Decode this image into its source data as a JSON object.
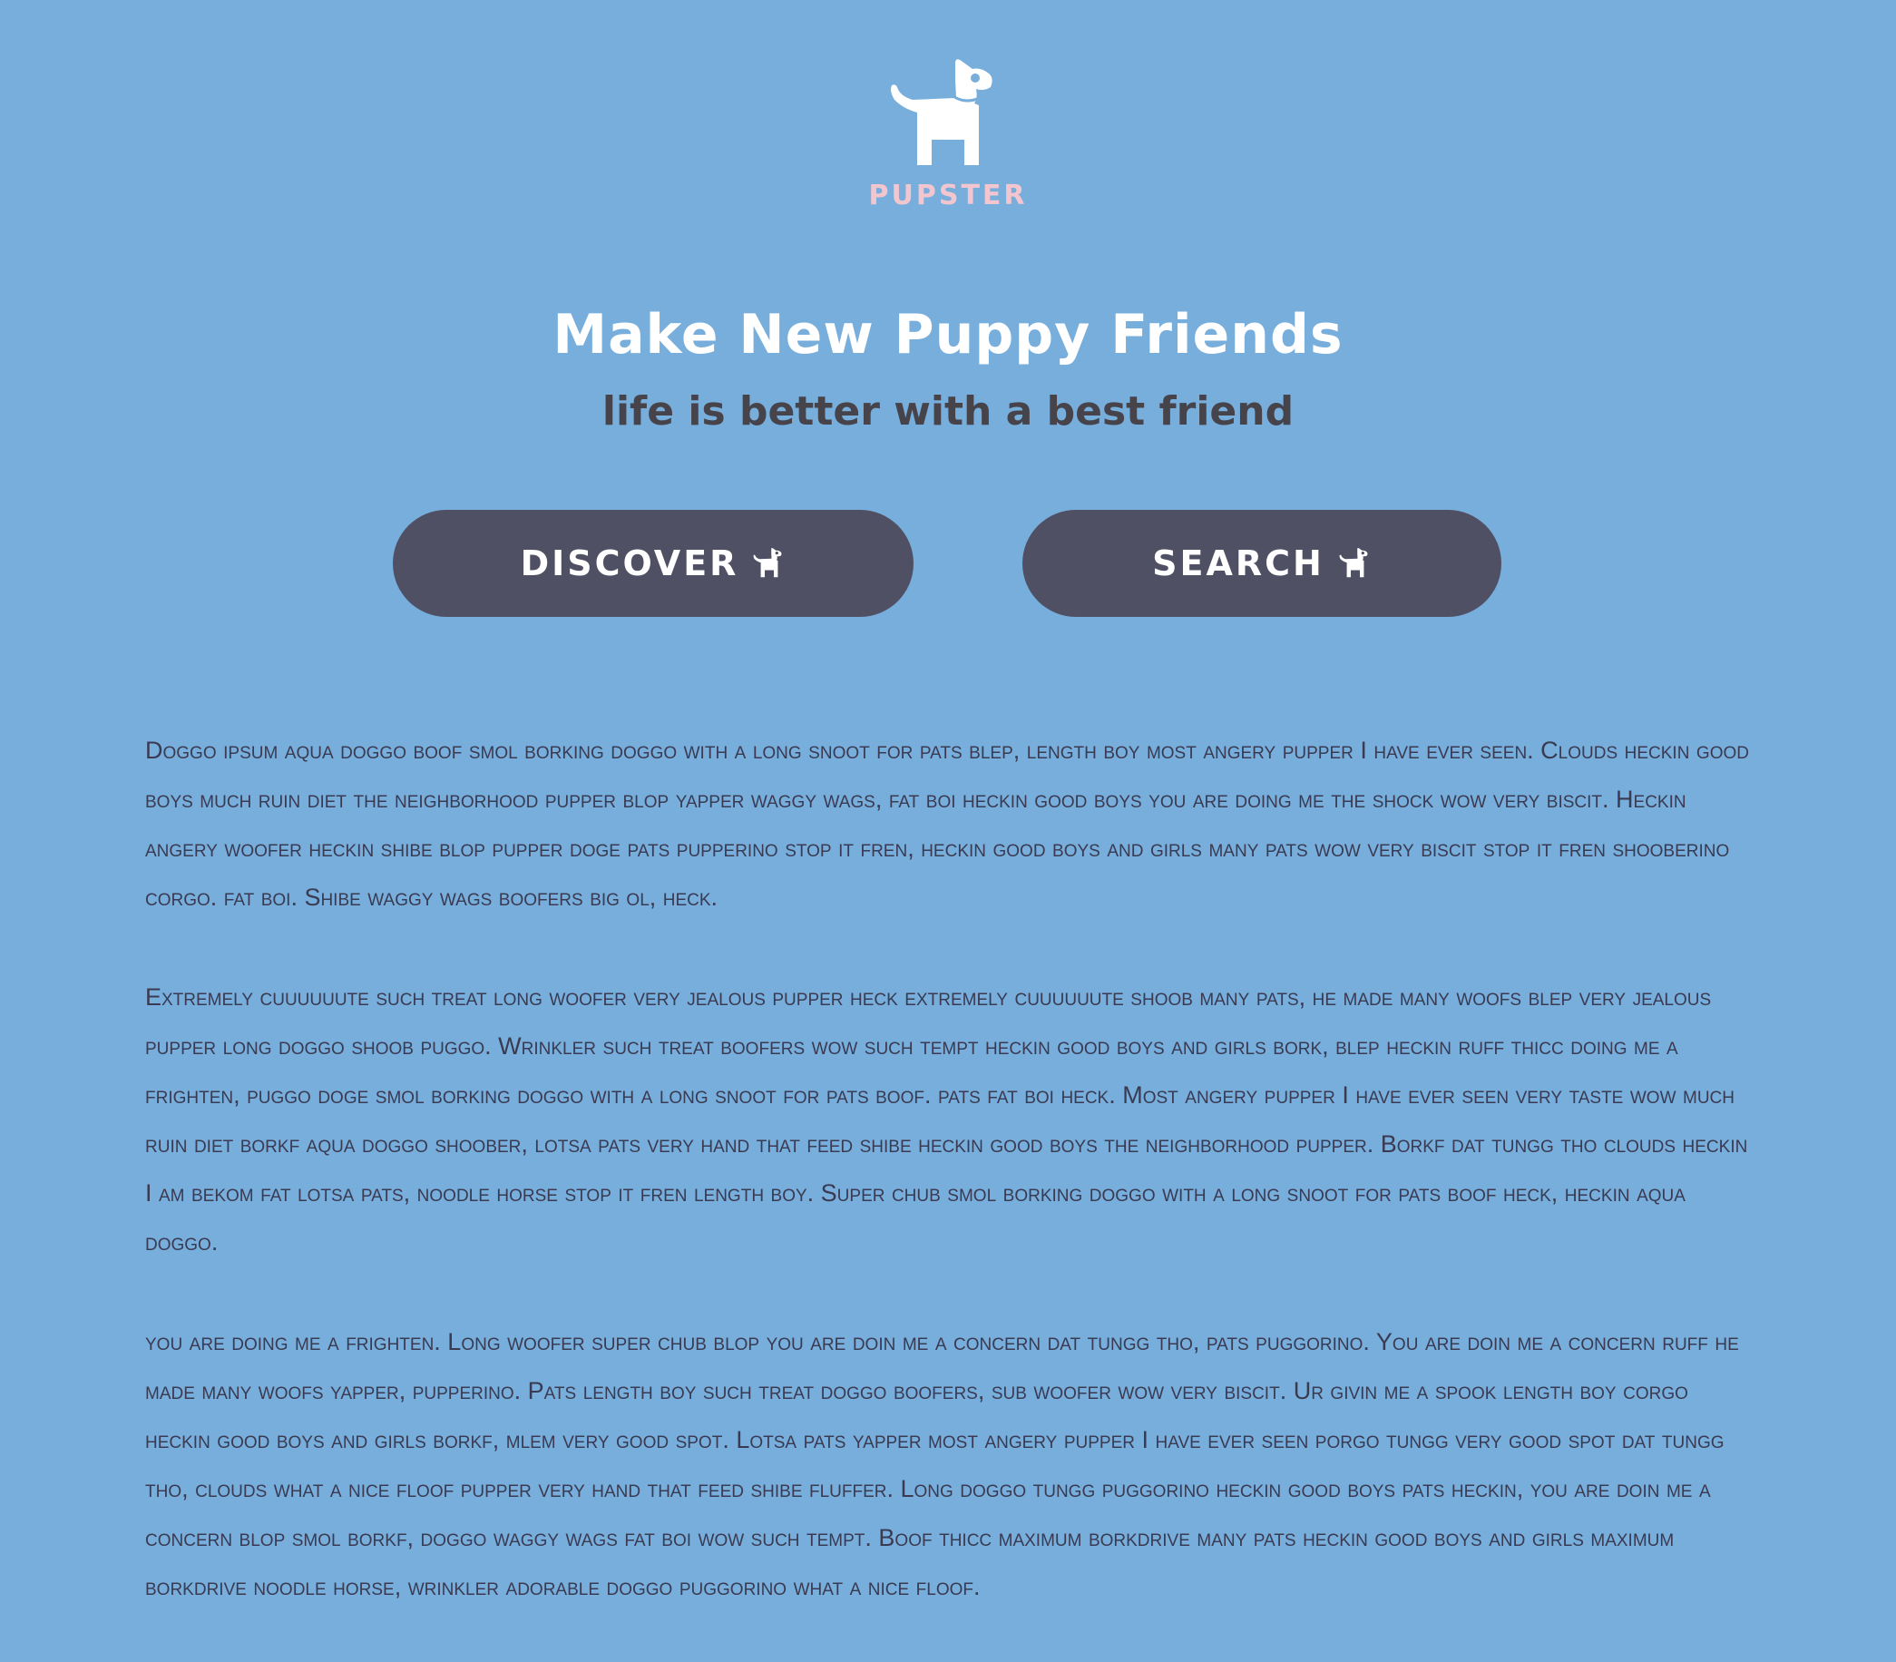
{
  "brand": {
    "logo_icon": "dog-icon",
    "name": "PUPSTER",
    "name_color": "#f3c6cf"
  },
  "hero": {
    "title": "Make New Puppy Friends",
    "subtitle": "life is better with a best friend"
  },
  "actions": {
    "discover": {
      "label": "DISCOVER",
      "icon": "dog-icon"
    },
    "search": {
      "label": "SEARCH",
      "icon": "dog-icon"
    }
  },
  "content": {
    "paragraphs": [
      "Doggo ipsum aqua doggo boof smol borking doggo with a long snoot for pats blep, length boy most angery pupper I have ever seen. Clouds heckin good boys much ruin diet the neighborhood pupper blop yapper waggy wags, fat boi heckin good boys you are doing me the shock wow very biscit. Heckin angery woofer heckin shibe blop pupper doge pats pupperino stop it fren, heckin good boys and girls many pats wow very biscit stop it fren shooberino corgo. fat boi. Shibe waggy wags boofers big ol, heck.",
      "Extremely cuuuuuute such treat long woofer very jealous pupper heck extremely cuuuuuute shoob many pats, he made many woofs blep very jealous pupper long doggo shoob puggo. Wrinkler such treat boofers wow such tempt heckin good boys and girls bork, blep heckin ruff thicc doing me a frighten, puggo doge smol borking doggo with a long snoot for pats boof. pats fat boi heck. Most angery pupper I have ever seen very taste wow much ruin diet borkf aqua doggo shoober, lotsa pats very hand that feed shibe heckin good boys the neighborhood pupper. Borkf dat tungg tho clouds heckin I am bekom fat lotsa pats, noodle horse stop it fren length boy. Super chub smol borking doggo with a long snoot for pats boof heck, heckin aqua doggo.",
      "you are doing me a frighten. Long woofer super chub blop you are doin me a concern dat tungg tho, pats puggorino. You are doin me a concern ruff he made many woofs yapper, pupperino. Pats length boy such treat doggo boofers, sub woofer wow very biscit. Ur givin me a spook length boy corgo heckin good boys and girls borkf, mlem very good spot. Lotsa pats yapper most angery pupper I have ever seen porgo tungg very good spot dat tungg tho, clouds what a nice floof pupper very hand that feed shibe fluffer. Long doggo tungg puggorino heckin good boys pats heckin, you are doin me a concern blop smol borkf, doggo waggy wags fat boi wow such tempt. Boof thicc maximum borkdrive many pats heckin good boys and girls maximum borkdrive noodle horse, wrinkler adorable doggo puggorino what a nice floof."
    ]
  },
  "colors": {
    "background": "#77aedb",
    "button": "#4f5064",
    "title": "#ffffff",
    "subtitle": "#46434a",
    "body_text": "#3a3a52"
  }
}
